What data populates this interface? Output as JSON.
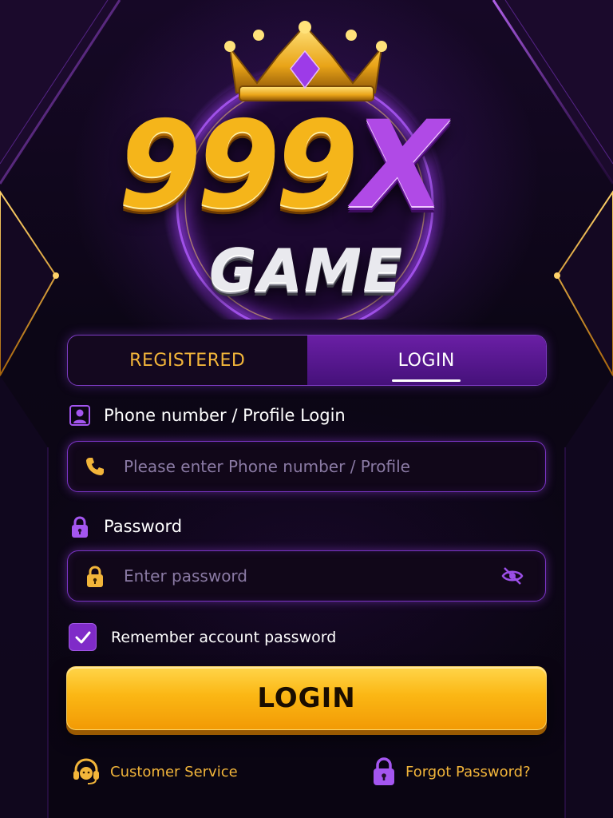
{
  "brand": {
    "logo_main": "999",
    "logo_x": "X",
    "logo_sub": "GAME"
  },
  "tabs": [
    {
      "label": "REGISTERED",
      "active": false
    },
    {
      "label": "LOGIN",
      "active": true
    }
  ],
  "form": {
    "phone_label": "Phone number / Profile Login",
    "phone_placeholder": "Please enter Phone number / Profile",
    "phone_value": "",
    "password_label": "Password",
    "password_placeholder": "Enter password",
    "password_value": "",
    "remember_label": "Remember account password",
    "remember_checked": true,
    "submit_label": "LOGIN"
  },
  "footer": {
    "customer_service": "Customer Service",
    "forgot_password": "Forgot Password?"
  },
  "icons": {
    "profile_label": "user-profile-icon",
    "phone_input": "phone-icon",
    "password_label": "lock-icon",
    "password_input": "lock-icon",
    "password_toggle": "eye-slash-icon",
    "checkbox": "checkmark-icon",
    "customer_service": "headset-icon",
    "forgot_password": "lock-icon"
  },
  "colors": {
    "accent_purple": "#7f2bc8",
    "accent_gold": "#f2b53a",
    "button_gold": "#fbb714",
    "background": "#0a0512"
  }
}
